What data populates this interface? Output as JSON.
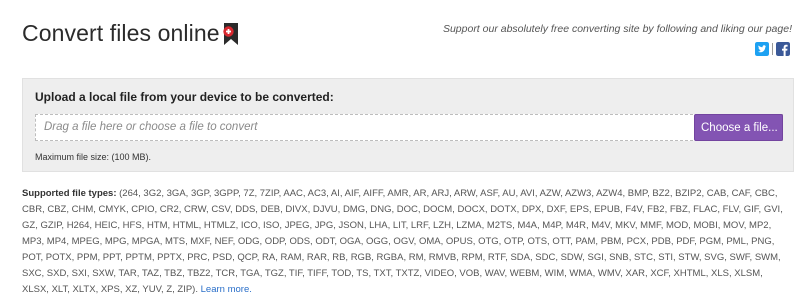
{
  "header": {
    "title": "Convert files online",
    "support_text": "Support our absolutely free converting site by following and liking our page!"
  },
  "social": [
    {
      "name": "twitter",
      "icon": "twitter-icon",
      "color": "#1da1f2"
    },
    {
      "name": "facebook",
      "icon": "facebook-icon",
      "color": "#3b5998"
    }
  ],
  "upload": {
    "heading": "Upload a local file from your device to be converted:",
    "placeholder": "Drag a file here or choose a file to convert",
    "button_label": "Choose a file...",
    "max_size": "Maximum file size: (100 MB)."
  },
  "supported": {
    "label": "Supported file types:",
    "types": "(264, 3G2, 3GA, 3GP, 3GPP, 7Z, 7ZIP, AAC, AC3, AI, AIF, AIFF, AMR, AR, ARJ, ARW, ASF, AU, AVI, AZW, AZW3, AZW4, BMP, BZ2, BZIP2, CAB, CAF, CBC, CBR, CBZ, CHM, CMYK, CPIO, CR2, CRW, CSV, DDS, DEB, DIVX, DJVU, DMG, DNG, DOC, DOCM, DOCX, DOTX, DPX, DXF, EPS, EPUB, F4V, FB2, FBZ, FLAC, FLV, GIF, GVI, GZ, GZIP, H264, HEIC, HFS, HTM, HTML, HTMLZ, ICO, ISO, JPEG, JPG, JSON, LHA, LIT, LRF, LZH, LZMA, M2TS, M4A, M4P, M4R, M4V, MKV, MMF, MOD, MOBI, MOV, MP2, MP3, MP4, MPEG, MPG, MPGA, MTS, MXF, NEF, ODG, ODP, ODS, ODT, OGA, OGG, OGV, OMA, OPUS, OTG, OTP, OTS, OTT, PAM, PBM, PCX, PDB, PDF, PGM, PML, PNG, POT, POTX, PPM, PPT, PPTM, PPTX, PRC, PSD, QCP, RA, RAM, RAR, RB, RGB, RGBA, RM, RMVB, RPM, RTF, SDA, SDC, SDW, SGI, SNB, STC, STI, STW, SVG, SWF, SWM, SXC, SXD, SXI, SXW, TAR, TAZ, TBZ, TBZ2, TCR, TGA, TGZ, TIF, TIFF, TOD, TS, TXT, TXTZ, VIDEO, VOB, WAV, WEBM, WIM, WMA, WMV, XAR, XCF, XHTML, XLS, XLSM, XLSX, XLT, XLTX, XPS, XZ, YUV, Z, ZIP).",
    "learn_more": "Learn more."
  },
  "colors": {
    "accent_button": "#8354b3",
    "link": "#2a6fc9",
    "panel_background": "#eeeeee"
  }
}
